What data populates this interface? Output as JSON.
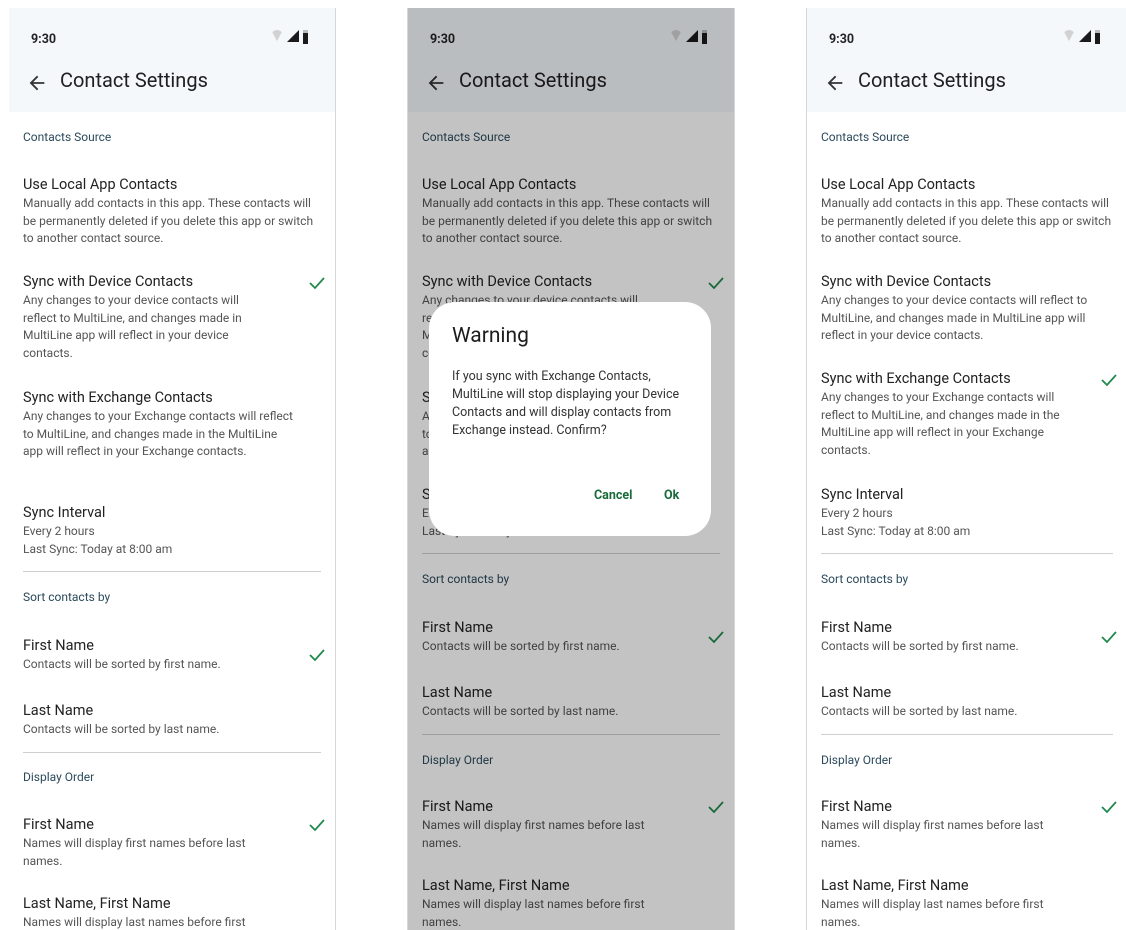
{
  "status_bar": {
    "time": "9:30"
  },
  "header": {
    "title": "Contact Settings"
  },
  "sections": {
    "contacts_source": "Contacts Source",
    "sort_by": "Sort contacts by",
    "display_order": "Display Order"
  },
  "source_items": {
    "local": {
      "title": "Use Local App Contacts",
      "desc": "Manually add contacts in this app. These contacts will be permanently deleted if you delete this app or switch to another contact source."
    },
    "device": {
      "title": "Sync with Device Contacts",
      "desc_narrow": "Any changes to your device contacts will reflect to MultiLine, and changes made in MultiLine app will reflect in your device contacts.",
      "desc_wide": "Any changes to your device contacts will reflect to MultiLine, and changes made in MultiLine app will reflect in your device contacts."
    },
    "exchange": {
      "title": "Sync with Exchange Contacts",
      "desc_a": "Any changes to your Exchange contacts will reflect to MultiLine, and changes made in the MultiLine app will reflect in your Exchange contacts.",
      "desc_b": "Any changes to your Exchange contacts will reflect to MultiLine, and changes made in the MultiLine app will reflect in your Exchange contacts."
    }
  },
  "sync_interval": {
    "title": "Sync Interval",
    "interval": "Every 2 hours",
    "last_sync": "Last Sync: Today at 8:00 am"
  },
  "sort_items": {
    "first": {
      "title": "First Name",
      "desc": "Contacts will be sorted by first name."
    },
    "last": {
      "title": "Last Name",
      "desc": "Contacts will be sorted by last name."
    }
  },
  "display_items": {
    "first": {
      "title": "First Name",
      "desc": "Names will display first names before last names."
    },
    "last_first": {
      "title": "Last Name, First Name",
      "desc": "Names will display last names before first names."
    }
  },
  "dialog": {
    "title": "Warning",
    "body": "If you sync with Exchange Contacts, MultiLine will stop displaying your Device Contacts and will display contacts from Exchange instead. Confirm?",
    "cancel": "Cancel",
    "ok": "Ok"
  },
  "colors": {
    "check": "#1f8a4c",
    "header_bg": "#f4f8fb",
    "section_text": "#2b4a5c",
    "dialog_button": "#1b6a3b"
  }
}
